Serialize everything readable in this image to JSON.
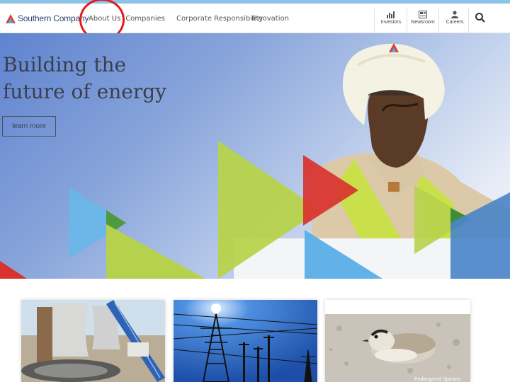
{
  "header": {
    "logo_text": "Southern Company",
    "nav": [
      "About Us",
      "Our Companies",
      "Corporate Responsibility",
      "Innovation"
    ],
    "utilities": [
      {
        "label": "Investors",
        "icon": "bar-chart-icon"
      },
      {
        "label": "Newsroom",
        "icon": "newspaper-icon"
      },
      {
        "label": "Careers",
        "icon": "person-icon"
      }
    ],
    "search_icon": "search-icon"
  },
  "hero": {
    "title_line1": "Building the",
    "title_line2": "future of energy",
    "button_label": "learn more"
  },
  "cards": {
    "plover_caption": "Endangered Species"
  },
  "annotation": {
    "color": "#e21b1b",
    "target": "About Us"
  },
  "colors": {
    "navy": "#2a3f6e",
    "lime": "#a9c843",
    "red": "#d9322f",
    "blue": "#5aaee8",
    "green": "#4f9a3d"
  }
}
